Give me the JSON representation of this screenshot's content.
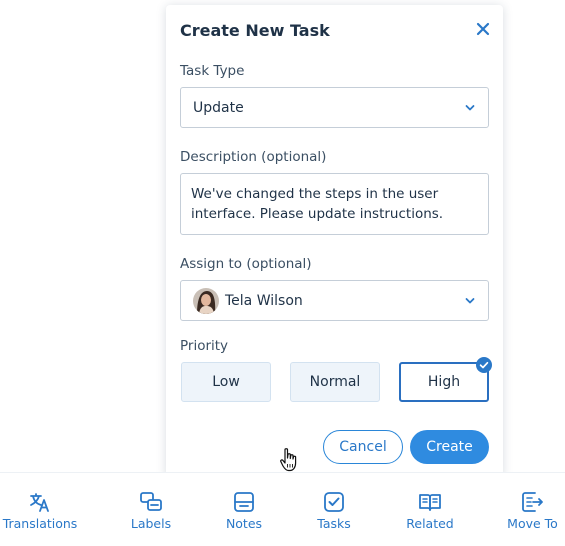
{
  "dialog": {
    "title": "Create New Task",
    "task_type": {
      "label": "Task Type",
      "value": "Update"
    },
    "description": {
      "label": "Description (optional)",
      "line1": "We've changed the steps in the user",
      "line2": "interface. Please update instructions."
    },
    "assign_to": {
      "label": "Assign to (optional)",
      "value": "Tela Wilson"
    },
    "priority": {
      "label": "Priority",
      "options": [
        "Low",
        "Normal",
        "High"
      ],
      "selected": "High"
    },
    "cancel_label": "Cancel",
    "create_label": "Create"
  },
  "nav": {
    "items": [
      {
        "label": "Translations",
        "icon": "translate-icon"
      },
      {
        "label": "Labels",
        "icon": "labels-icon"
      },
      {
        "label": "Notes",
        "icon": "notes-icon"
      },
      {
        "label": "Tasks",
        "icon": "tasks-icon"
      },
      {
        "label": "Related",
        "icon": "related-icon"
      },
      {
        "label": "Move To",
        "icon": "move-to-icon"
      }
    ]
  },
  "colors": {
    "accent": "#2f8be0",
    "selected_border": "#2a6fc0",
    "nav_text": "#2a78c8",
    "title_text": "#1f3247"
  }
}
